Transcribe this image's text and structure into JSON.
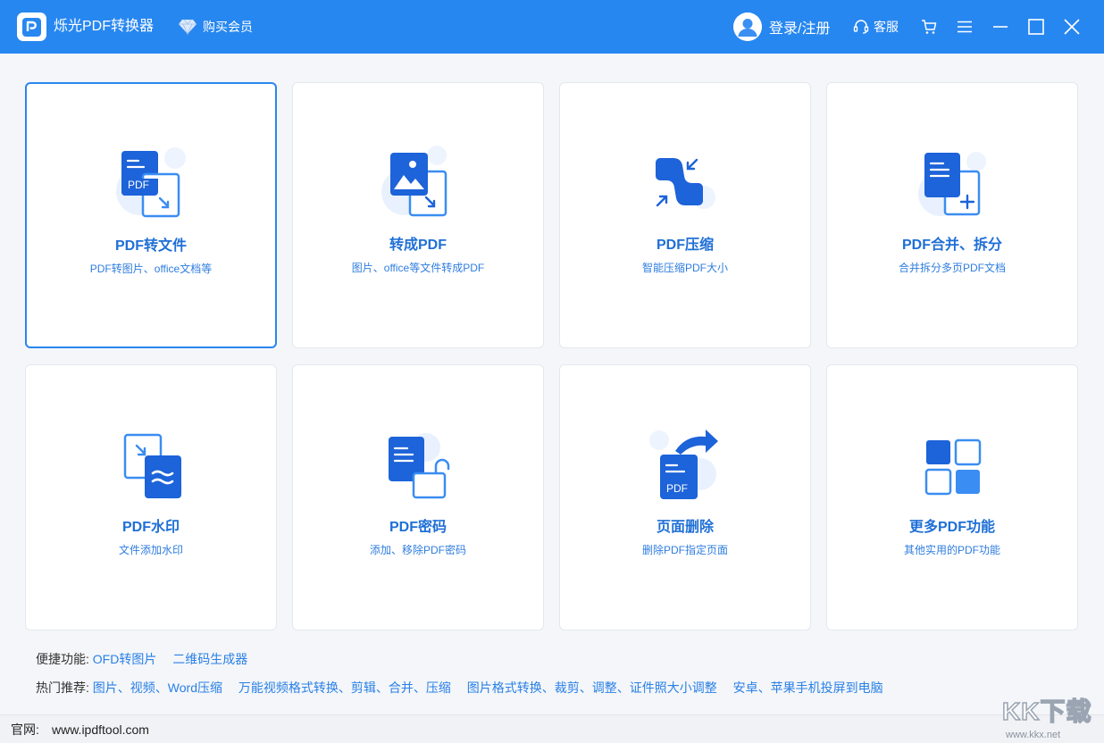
{
  "app": {
    "title": "烁光PDF转换器",
    "vip_label": "购买会员",
    "login_label": "登录/注册",
    "service_label": "客服"
  },
  "icons": {
    "logo": "pdf-logo-icon",
    "vip": "diamond-icon",
    "avatar": "user-avatar-icon",
    "service": "headset-icon",
    "cart": "cart-icon",
    "menu": "menu-icon",
    "minimize": "minimize-icon",
    "maximize": "maximize-icon",
    "close": "close-icon"
  },
  "colors": {
    "titlebar": "#2787f0",
    "accent": "#1f6fd6",
    "icon_dark": "#1d63d9",
    "icon_light": "#4aa3ff",
    "icon_bg": "#e8f1fd"
  },
  "cards": [
    {
      "title": "PDF转文件",
      "desc": "PDF转图片、office文档等",
      "icon": "pdf-to-file-icon",
      "icon_text": "PDF",
      "selected": true
    },
    {
      "title": "转成PDF",
      "desc": "图片、office等文件转成PDF",
      "icon": "to-pdf-icon",
      "selected": false
    },
    {
      "title": "PDF压缩",
      "desc": "智能压缩PDF大小",
      "icon": "compress-icon",
      "selected": false
    },
    {
      "title": "PDF合并、拆分",
      "desc": "合并拆分多页PDF文档",
      "icon": "merge-split-icon",
      "selected": false
    },
    {
      "title": "PDF水印",
      "desc": "文件添加水印",
      "icon": "watermark-icon",
      "selected": false
    },
    {
      "title": "PDF密码",
      "desc": "添加、移除PDF密码",
      "icon": "password-icon",
      "selected": false
    },
    {
      "title": "页面删除",
      "desc": "删除PDF指定页面",
      "icon": "page-delete-icon",
      "icon_text": "PDF",
      "selected": false
    },
    {
      "title": "更多PDF功能",
      "desc": "其他实用的PDF功能",
      "icon": "more-functions-icon",
      "selected": false
    }
  ],
  "quick": {
    "label": "便捷功能:",
    "links": [
      "OFD转图片",
      "二维码生成器"
    ]
  },
  "hot": {
    "label": "热门推荐:",
    "links": [
      "图片、视频、Word压缩",
      "万能视频格式转换、剪辑、合并、压缩",
      "图片格式转换、裁剪、调整、证件照大小调整",
      "安卓、苹果手机投屏到电脑"
    ]
  },
  "status": {
    "site_label": "官网:",
    "site_url": "www.ipdftool.com"
  },
  "watermark": {
    "text": "KK下载",
    "url": "www.kkx.net"
  }
}
